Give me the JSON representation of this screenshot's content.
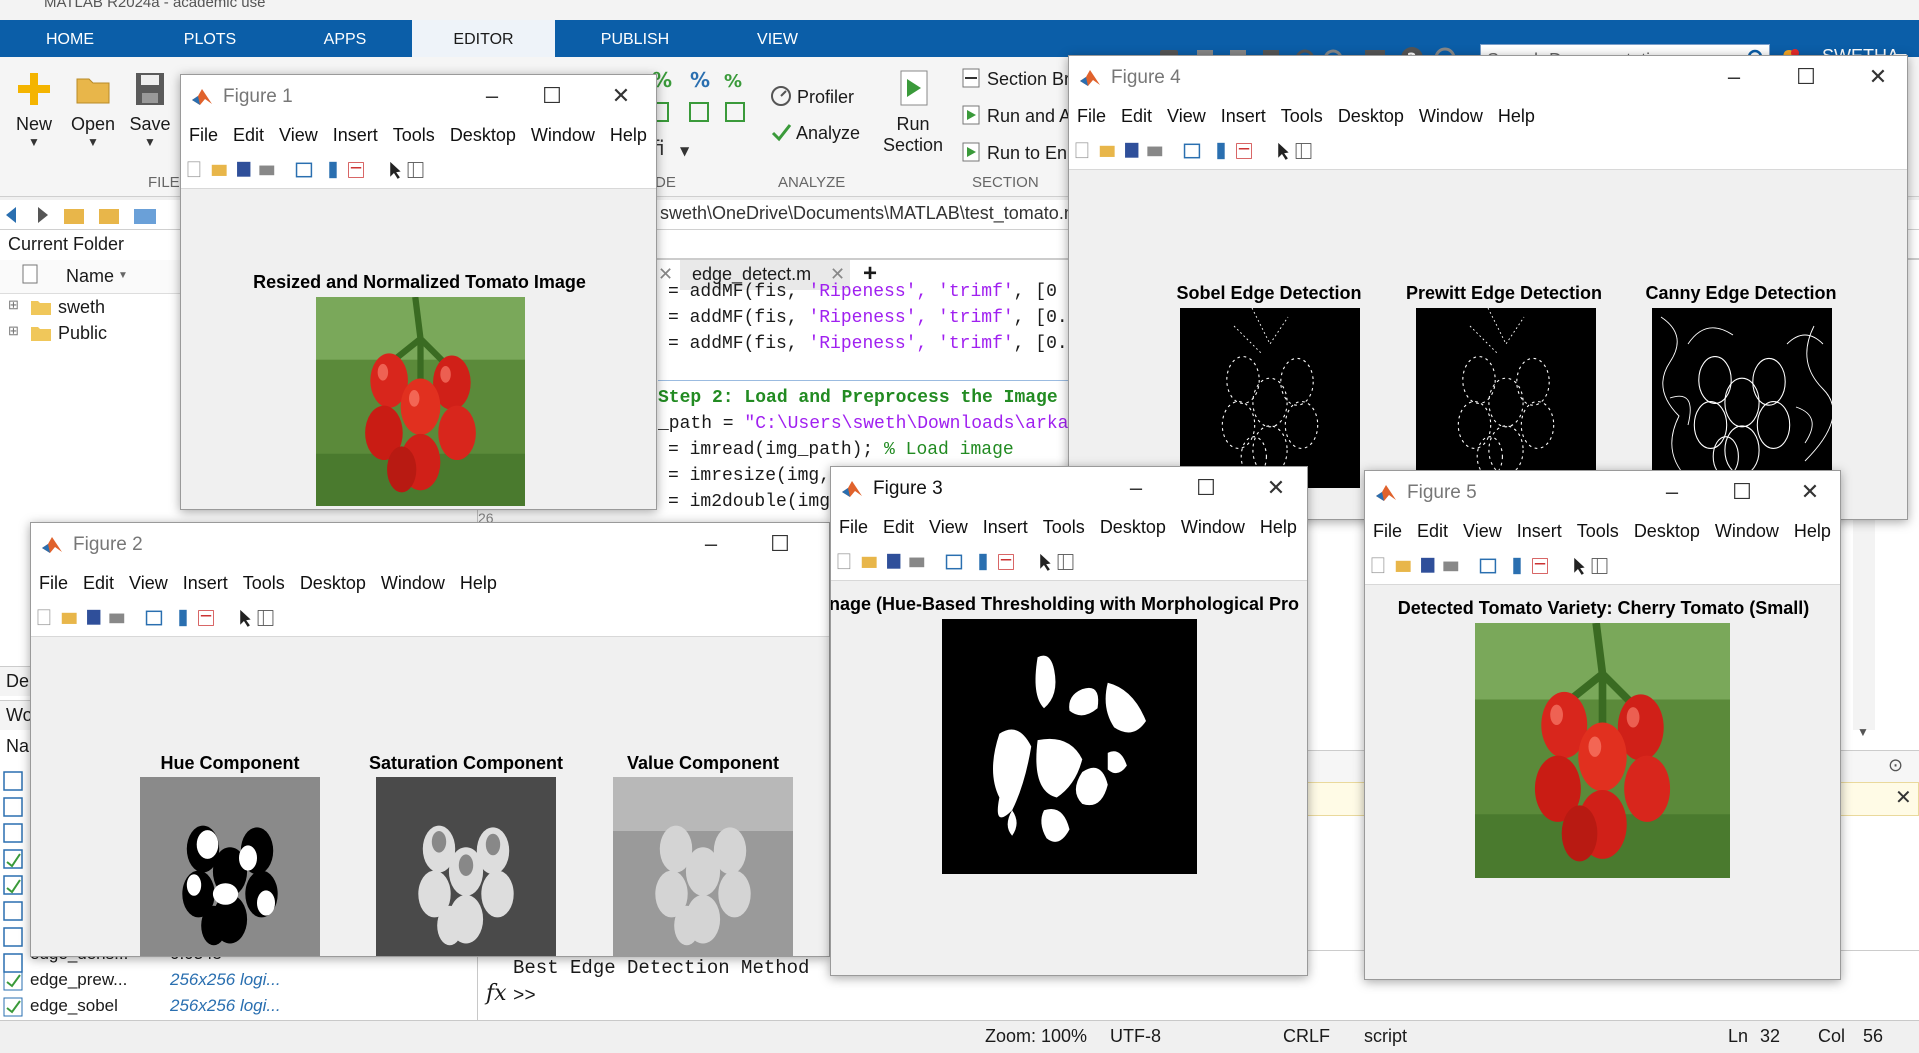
{
  "app": {
    "window_title": "MATLAB R2024a - academic use",
    "tabs": [
      "HOME",
      "PLOTS",
      "APPS",
      "EDITOR",
      "PUBLISH",
      "VIEW"
    ],
    "active_tab": "EDITOR",
    "search_placeholder": "Search Documentation",
    "user": "SWETHA"
  },
  "ribbon": {
    "new_label": "New",
    "open_label": "Open",
    "save_label": "Save",
    "file_section": "FILE",
    "profiler_label": "Profiler",
    "analyze_label": "Analyze",
    "analyze_section": "ANALYZE",
    "run_section_label_1": "Run",
    "run_section_label_2": "Section",
    "section_break_label": "Section Br",
    "run_and_advance_label": "Run and A",
    "run_to_end_label": "Run to En",
    "section_section": "SECTION",
    "de_section": "DE"
  },
  "path": {
    "text": "sweth\\OneDrive\\Documents\\MATLAB\\test_tomato.m"
  },
  "current_folder": {
    "title": "Current Folder",
    "column_name": "Name",
    "items": [
      "sweth",
      "Public"
    ]
  },
  "workspace": {
    "title_stub": "De",
    "tab_stub": "Wo",
    "col_stub": "Na",
    "rows": [
      {
        "name": "edge_dens...",
        "value": "0.0345"
      },
      {
        "name": "edge_prew...",
        "value": "256x256 logi..."
      },
      {
        "name": "edge_sobel",
        "value": "256x256 logi..."
      }
    ]
  },
  "editor": {
    "file_tab": "edge_detect.m",
    "add_tab": "+",
    "lines": [
      {
        "pre": "= addMF(fis, ",
        "str": "'Ripeness', 'trimf'",
        "post": ", [0"
      },
      {
        "pre": "= addMF(fis, ",
        "str": "'Ripeness', 'trimf'",
        "post": ", [0."
      },
      {
        "pre": "= addMF(fis, ",
        "str": "'Ripeness', 'trimf'",
        "post": ", [0."
      }
    ],
    "step2": "Step 2: Load and Preprocess the Image",
    "l_path_pre": "_path = ",
    "l_path_str": "\"C:\\Users\\sweth\\Downloads\\arka",
    "l_read_pre": "= imread(img_path); ",
    "l_read_cmt": "% Load image",
    "l_resize": "= imresize(img,",
    "l_double": "= im2double(img",
    "line_num": "26"
  },
  "command": {
    "output": "Best Edge Detection Method",
    "prompt": ">>",
    "fx": "fx"
  },
  "status": {
    "zoom": "Zoom: 100%",
    "encoding": "UTF-8",
    "eol": "CRLF",
    "type": "script",
    "ln_label": "Ln",
    "ln": "32",
    "col_label": "Col",
    "col": "56"
  },
  "figure_menu": [
    "File",
    "Edit",
    "View",
    "Insert",
    "Tools",
    "Desktop",
    "Window",
    "Help"
  ],
  "figures": {
    "f1": {
      "title": "Figure 1",
      "plot_title": "Resized and Normalized Tomato Image"
    },
    "f2": {
      "title": "Figure 2",
      "plots": [
        "Hue Component",
        "Saturation Component",
        "Value Component"
      ]
    },
    "f3": {
      "title": "Figure 3",
      "plot_title": "nage (Hue-Based Thresholding with Morphological Pro"
    },
    "f4": {
      "title": "Figure 4",
      "plots": [
        "Sobel Edge Detection",
        "Prewitt Edge Detection",
        "Canny Edge Detection"
      ]
    },
    "f5": {
      "title": "Figure 5",
      "plot_title": "Detected Tomato Variety: Cherry Tomato (Small)"
    }
  },
  "colors": {
    "ribbon_blue": "#0b5ea8",
    "tomato_red": "#d8261c",
    "keyword_purple": "#a020f0",
    "comment_green": "#228b22"
  }
}
